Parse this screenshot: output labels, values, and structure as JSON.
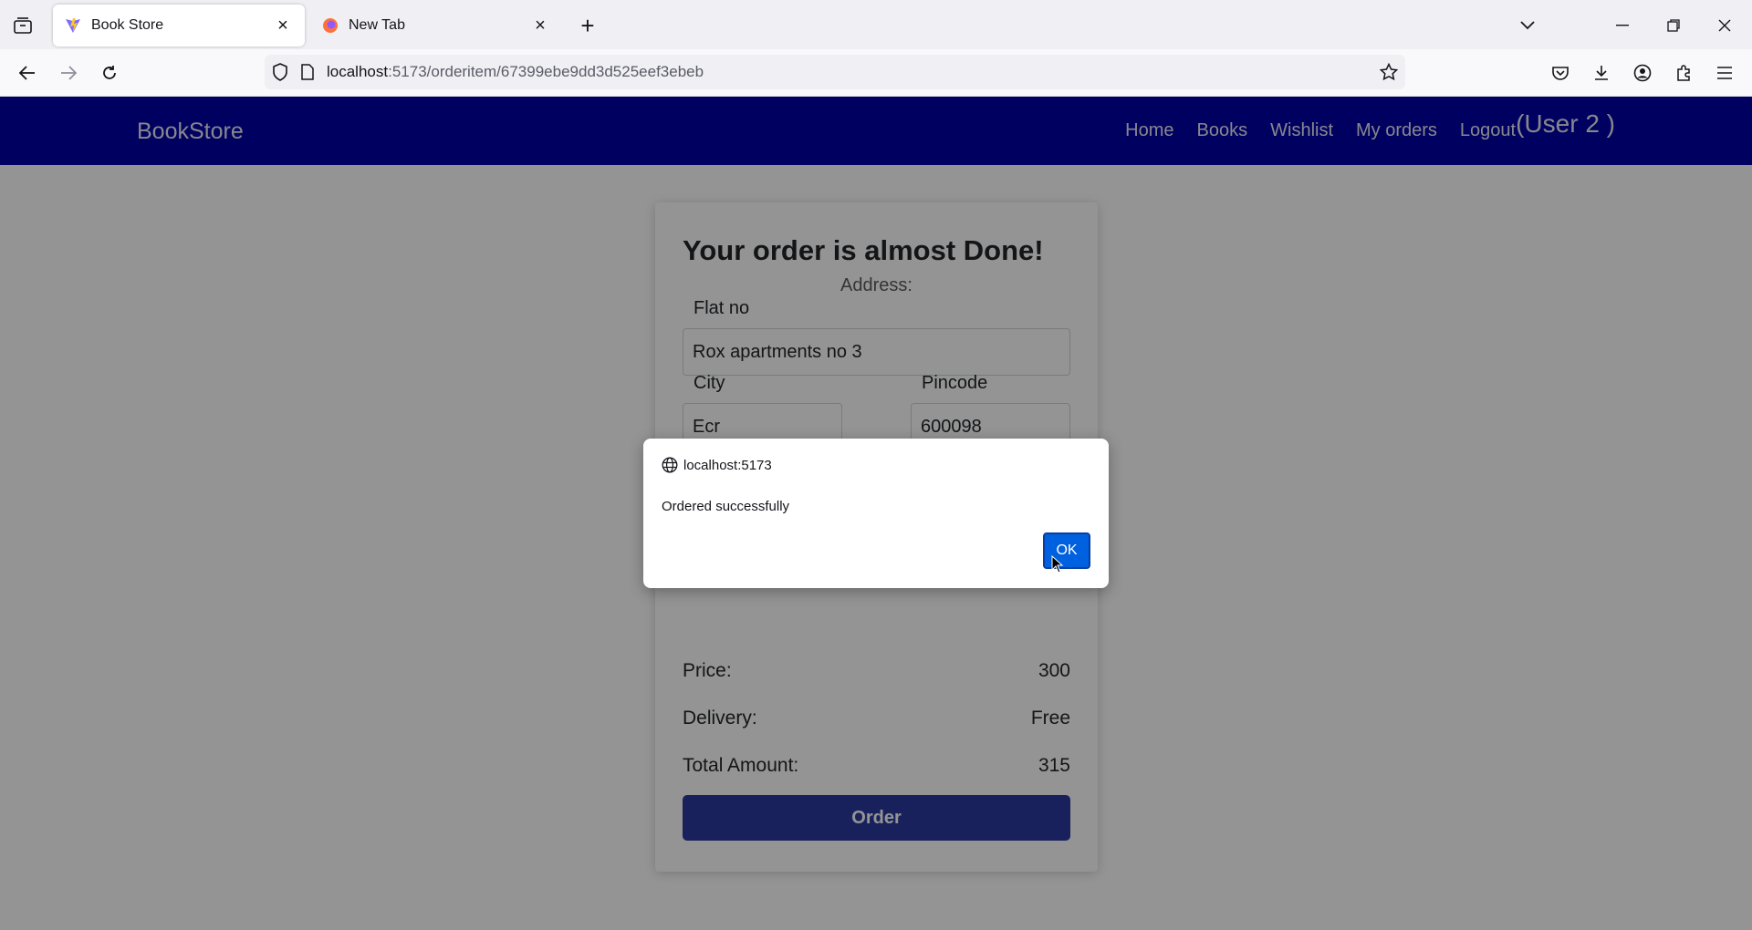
{
  "browser": {
    "tabs": [
      {
        "label": "Book Store",
        "active": true,
        "icon": "vite-icon"
      },
      {
        "label": "New Tab",
        "active": false,
        "icon": "firefox-icon"
      }
    ],
    "url": {
      "host": "localhost",
      "path": ":5173/orderitem/67399ebe9dd3d525eef3ebeb"
    }
  },
  "site": {
    "brand": "BookStore",
    "nav": {
      "home": "Home",
      "books": "Books",
      "wishlist": "Wishlist",
      "orders": "My orders",
      "logout": "Logout",
      "user": "(User 2 )"
    },
    "accent_color": "#0000a5"
  },
  "order": {
    "heading": "Your order is almost Done!",
    "address_label": "Address:",
    "flat_label": "Flat no",
    "flat_value": "Rox apartments no 3",
    "city_label": "City",
    "city_value": "Ecr",
    "pincode_label": "Pincode",
    "pincode_value": "600098",
    "price_label": "Price:",
    "price_value": "300",
    "delivery_label": "Delivery:",
    "delivery_value": "Free",
    "total_label": "Total Amount:",
    "total_value": "315",
    "order_button": "Order"
  },
  "dialog": {
    "origin": "localhost:5173",
    "message": "Ordered successfully",
    "ok_label": "OK"
  }
}
